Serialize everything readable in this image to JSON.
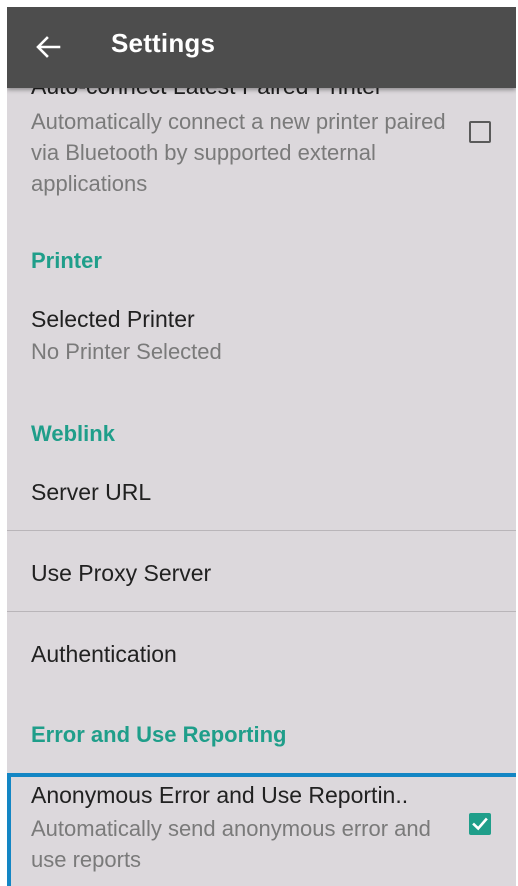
{
  "appbar": {
    "title": "Settings"
  },
  "prefs": {
    "auto_connect": {
      "title": "Auto-connect Latest Paired Printer",
      "summary": "Automatically connect a new printer paired via Bluetooth by supported external applications",
      "checked": false
    },
    "printer_header": "Printer",
    "selected_printer": {
      "title": "Selected Printer",
      "summary": "No Printer Selected"
    },
    "weblink_header": "Weblink",
    "server_url": "Server URL",
    "use_proxy": "Use Proxy Server",
    "authentication": "Authentication",
    "reporting_header": "Error and Use Reporting",
    "anonymous_reporting": {
      "title": "Anonymous Error and Use Reportin..",
      "summary": "Automatically send anonymous error and use reports",
      "checked": true
    }
  },
  "colors": {
    "accent": "#1f9e8a",
    "appbar": "#4d4d4d",
    "background": "#dcd8dc",
    "focus": "#1386c4"
  }
}
